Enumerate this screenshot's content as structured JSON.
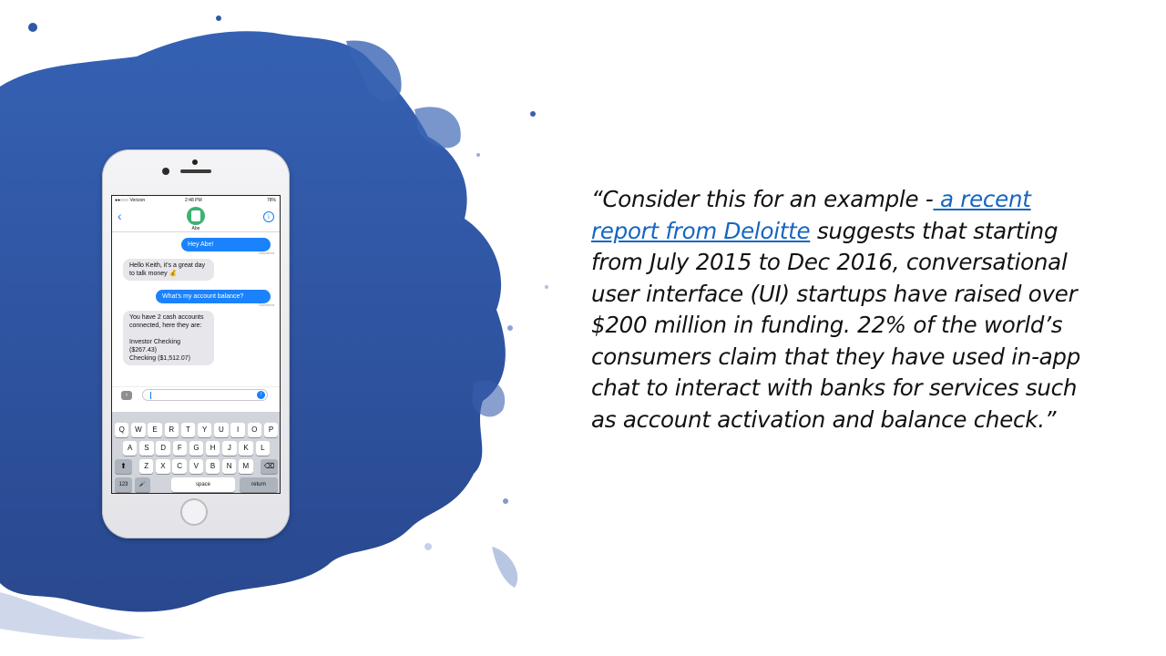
{
  "phone": {
    "status": {
      "carrier": "●●○○○ Verizon",
      "time": "2:48 PM",
      "battery": "78%"
    },
    "contact_name": "Abe",
    "messages": [
      {
        "from": "me",
        "text": "Hey Abe!"
      },
      {
        "from": "bot",
        "text": "Hello Keith, it's a great day to talk money 💰"
      },
      {
        "from": "me",
        "text": "What's my account balance?"
      },
      {
        "from": "bot",
        "text": "You have 2 cash accounts connected, here they are:\n\nInvestor Checking ($267.43)\nChecking ($1,512.07)"
      }
    ],
    "delivered_label": "Delivered",
    "keyboard": {
      "row1": [
        "Q",
        "W",
        "E",
        "R",
        "T",
        "Y",
        "U",
        "I",
        "O",
        "P"
      ],
      "row2": [
        "A",
        "S",
        "D",
        "F",
        "G",
        "H",
        "J",
        "K",
        "L"
      ],
      "row3": [
        "Z",
        "X",
        "C",
        "V",
        "B",
        "N",
        "M"
      ],
      "shift": "⬆",
      "delete": "⌫",
      "numbers": "123",
      "mic": "🎤",
      "space": "space",
      "return": "return"
    }
  },
  "quote": {
    "before": "“Consider this for an example -",
    "link_text": " a recent report from Deloitte",
    "after": " suggests that starting from July 2015 to Dec 2016, conversational user interface (UI) startups have raised over $200 million in funding. 22% of the world’s consumers claim that they have used in-app chat to interact with banks for services such as account activation and balance check.”"
  },
  "colors": {
    "splash": "#2f58a6",
    "link": "#1565c0",
    "bubble_out": "#1a82fb",
    "bubble_in": "#e6e6eb"
  }
}
